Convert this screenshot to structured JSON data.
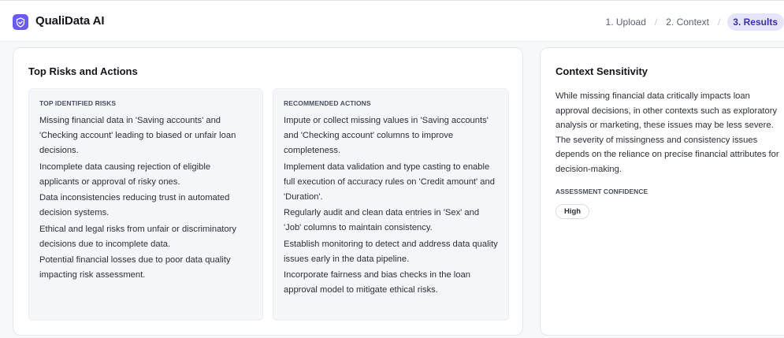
{
  "header": {
    "brand": "QualiData AI",
    "steps": [
      {
        "label": "1. Upload"
      },
      {
        "label": "2. Context"
      },
      {
        "label": "3. Results"
      }
    ],
    "separator": "/"
  },
  "main": {
    "title": "Top Risks and Actions",
    "risks": {
      "heading": "TOP IDENTIFIED RISKS",
      "items": [
        "Missing financial data in 'Saving accounts' and 'Checking account' leading to biased or unfair loan decisions.",
        "Incomplete data causing rejection of eligible applicants or approval of risky ones.",
        "Data inconsistencies reducing trust in automated decision systems.",
        "Ethical and legal risks from unfair or discriminatory decisions due to incomplete data.",
        "Potential financial losses due to poor data quality impacting risk assessment."
      ]
    },
    "actions": {
      "heading": "RECOMMENDED ACTIONS",
      "items": [
        "Impute or collect missing values in 'Saving accounts' and 'Checking account' columns to improve completeness.",
        "Implement data validation and type casting to enable full execution of accuracy rules on 'Credit amount' and 'Duration'.",
        "Regularly audit and clean data entries in 'Sex' and 'Job' columns to maintain consistency.",
        "Establish monitoring to detect and address data quality issues early in the data pipeline.",
        "Incorporate fairness and bias checks in the loan approval model to mitigate ethical risks."
      ]
    }
  },
  "side": {
    "title": "Context Sensitivity",
    "text": "While missing financial data critically impacts loan approval decisions, in other contexts such as exploratory analysis or marketing, these issues may be less severe. The severity of missingness and consistency issues depends on the reliance on precise financial attributes for decision-making.",
    "confidence_label": "ASSESSMENT CONFIDENCE",
    "confidence_value": "High"
  },
  "colors": {
    "accent": "#6b5cf0",
    "active_step_bg": "#e6e4fb",
    "active_step_text": "#3a2fa8"
  },
  "icons": {
    "logo": "shield-check-icon"
  }
}
